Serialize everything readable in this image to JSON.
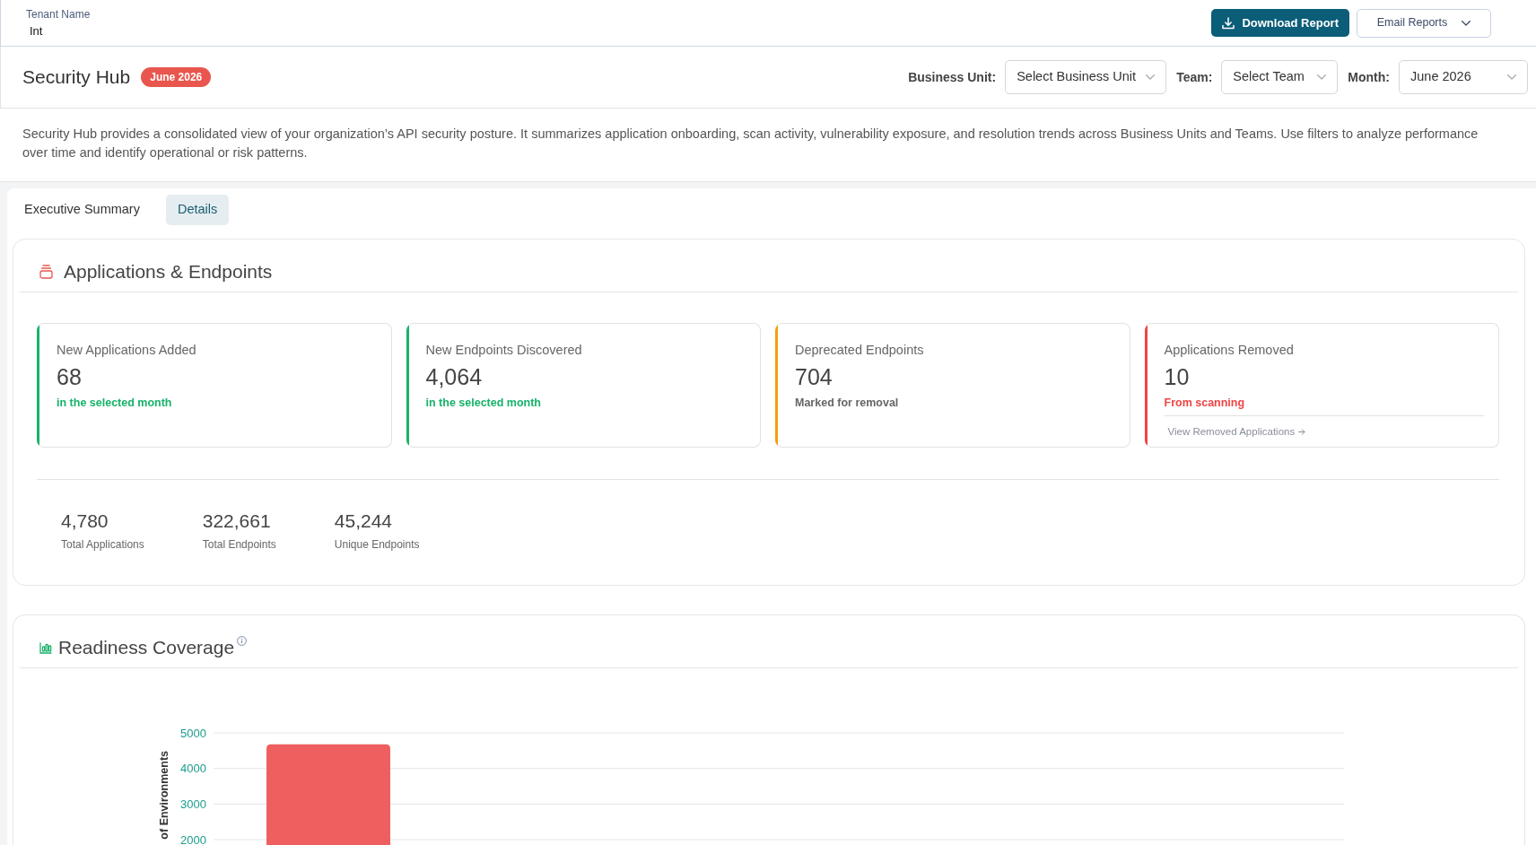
{
  "header": {
    "tenant_label": "Tenant Name",
    "tenant_value": "Int",
    "buttons": [
      {
        "label": "Download Report",
        "kind": "primary"
      },
      {
        "label": "Email Reports",
        "kind": "dropdown"
      }
    ]
  },
  "page": {
    "title": "Security Hub",
    "badge": "June 2026",
    "filters": [
      {
        "label": "Business Unit:",
        "value": "Select Business Unit"
      },
      {
        "label": "Team:",
        "value": "Select Team"
      },
      {
        "label": "Month:",
        "value": "June 2026"
      }
    ],
    "description": "Security Hub provides a consolidated view of your organization’s API security posture. It summarizes application onboarding, scan activity, vulnerability exposure, and resolution trends across Business Units and Teams. Use filters to analyze performance over time and identify operational or risk patterns."
  },
  "tabs": [
    {
      "label": "Executive Summary",
      "selected": false
    },
    {
      "label": "Details",
      "selected": true
    }
  ],
  "applications_section": {
    "title": "Applications & Endpoints",
    "cards": [
      {
        "label": "New Applications Added",
        "value": "68",
        "note": {
          "text": "in the selected month",
          "color": "#17b26a"
        },
        "color": "#17b26a"
      },
      {
        "label": "New Endpoints Discovered",
        "value": "4,064",
        "note": {
          "text": "in the selected month",
          "color": "#17b26a"
        },
        "color": "#17b26a"
      },
      {
        "label": "Deprecated Endpoints",
        "value": "704",
        "note": {
          "text": "Marked for removal",
          "color": "#666666"
        },
        "color": "#f59e0b"
      },
      {
        "label": "Applications Removed",
        "value": "10",
        "note": {
          "text": "From scanning",
          "color": "#ef4444"
        },
        "color": "#ef4444",
        "link": "View Removed Applications"
      }
    ],
    "totals": [
      {
        "value": "4,780",
        "label": "Total Applications"
      },
      {
        "value": "322,661",
        "label": "Total Endpoints"
      },
      {
        "value": "45,244",
        "label": "Unique Endpoints"
      }
    ]
  },
  "readiness_section": {
    "title": "Readiness Coverage",
    "chart_data": {
      "type": "bar",
      "ylabel": "of Environments",
      "ylim": [
        1800,
        5000
      ],
      "yticks": [
        2000,
        3000,
        4000,
        5000
      ],
      "grid": true,
      "series": [
        {
          "color": "#ef5f5f",
          "values": [
            4680
          ]
        }
      ]
    }
  }
}
